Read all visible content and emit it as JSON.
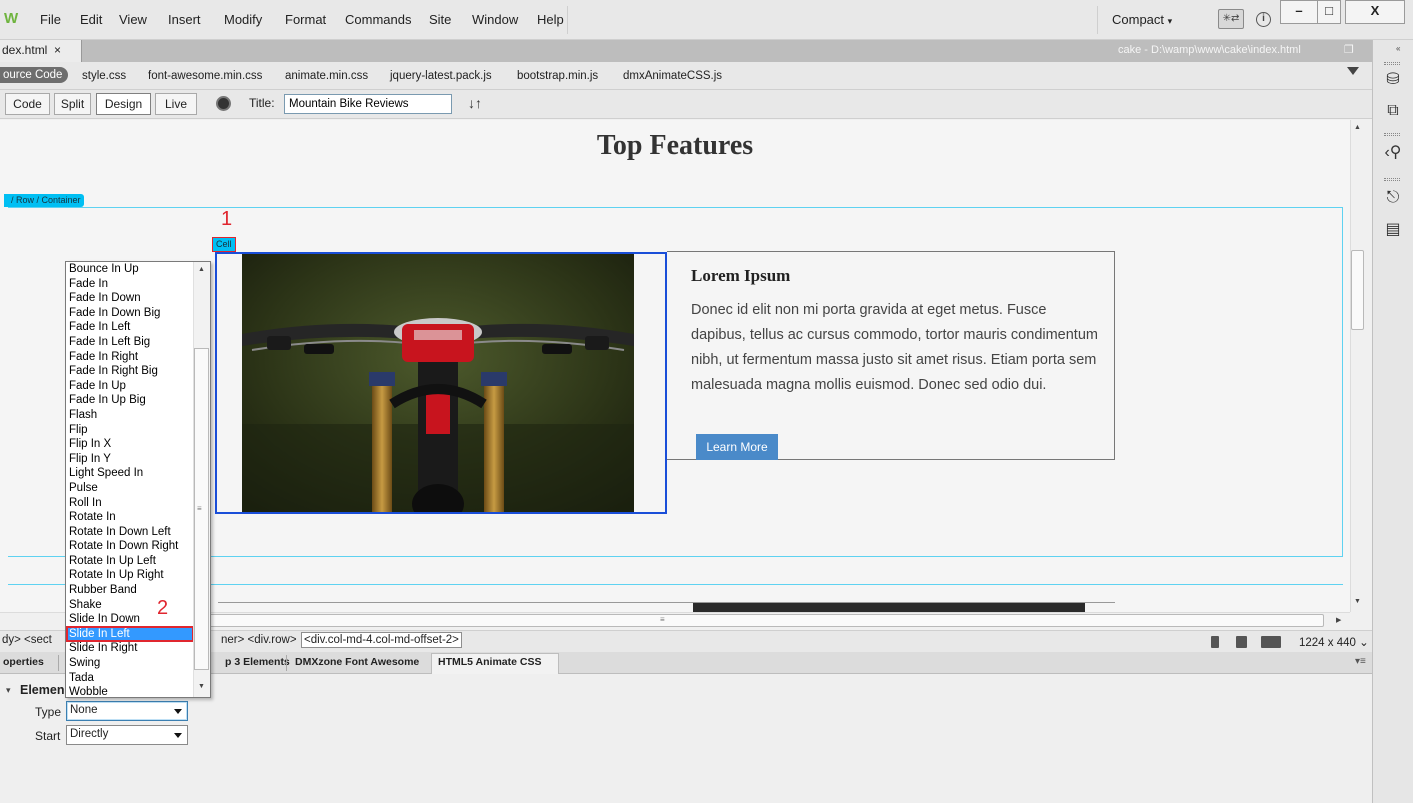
{
  "menubar": {
    "logo": "W",
    "items": [
      "File",
      "Edit",
      "View",
      "Insert",
      "Modify",
      "Format",
      "Commands",
      "Site",
      "Window",
      "Help"
    ],
    "workspace": "Compact",
    "sync": "✳⇄",
    "info": "i",
    "window_controls": [
      "–",
      "□",
      "X"
    ]
  },
  "document": {
    "tab_label": "dex.html",
    "close": "×",
    "path": "cake - D:\\wamp\\www\\cake\\index.html",
    "restore": "❐"
  },
  "related_files": {
    "source_code": "ource Code",
    "files": [
      "style.css",
      "font-awesome.min.css",
      "animate.min.css",
      "jquery-latest.pack.js",
      "bootstrap.min.js",
      "dmxAnimateCSS.js"
    ]
  },
  "view_toolbar": {
    "buttons": [
      "Code",
      "Split",
      "Design",
      "Live"
    ],
    "active": "Design",
    "title_label": "Title:",
    "title_value": "Mountain Bike Reviews",
    "sort": "↓↑"
  },
  "canvas": {
    "heading": "Top Features",
    "row_tag": "/ Row / Container",
    "cell_tag": "Cell",
    "lorem_title": "Lorem Ipsum",
    "lorem_body": "Donec id elit non mi porta gravida at eget metus. Fusce dapibus, tellus ac cursus commodo, tortor mauris condimentum nibh, ut fermentum massa justo sit amet risus. Etiam porta sem malesuada magna mollis euismod. Donec sed odio dui.",
    "learn_more": "Learn More"
  },
  "annotations": {
    "step1": "1",
    "step2": "2"
  },
  "status_bar": {
    "tag_path_left": "dy> <sect",
    "tag_path_mid": "ner> <div.row>",
    "tag_path_selected": "<div.col-md-4.col-md-offset-2>",
    "size": "1224 x 440 ⌄"
  },
  "panel_tabs": [
    "operties",
    "p 3 Elements",
    "DMXzone Font Awesome",
    "HTML5 Animate CSS"
  ],
  "panel_tabs_active": "HTML5 Animate CSS",
  "properties": {
    "section_label": "Elemen",
    "type_label": "Type",
    "type_value": "None",
    "start_label": "Start",
    "start_value": "Directly"
  },
  "animation_options": [
    "Bounce In Up",
    "Fade In",
    "Fade In Down",
    "Fade In Down Big",
    "Fade In Left",
    "Fade In Left Big",
    "Fade In Right",
    "Fade In Right Big",
    "Fade In Up",
    "Fade In Up Big",
    "Flash",
    "Flip",
    "Flip In X",
    "Flip In Y",
    "Light Speed In",
    "Pulse",
    "Roll In",
    "Rotate In",
    "Rotate In Down Left",
    "Rotate In Down Right",
    "Rotate In Up Left",
    "Rotate In Up Right",
    "Rubber Band",
    "Shake",
    "Slide In Down",
    "Slide In Left",
    "Slide In Right",
    "Swing",
    "Tada",
    "Wobble"
  ],
  "animation_selected": "Slide In Left"
}
